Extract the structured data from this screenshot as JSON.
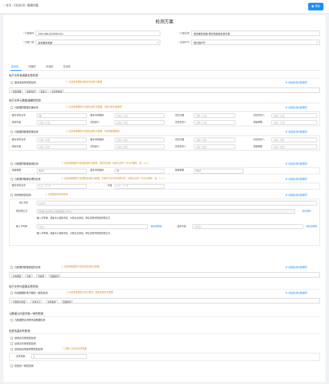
{
  "breadcrumb": {
    "home": "首页",
    "sep1": "/",
    "mid": "归档检测",
    "sep2": "/",
    "current": "检测方案"
  },
  "toolbar": {
    "save_label": "保存"
  },
  "title": "检测方案",
  "form": {
    "plan_no_label": "方案编号",
    "plan_no_value": "GKH-068-2023092l-001",
    "plan_name_label": "方案名称",
    "plan_name_value": "政务服务档案-预归档接收检测方案",
    "dept_label": "归属门类",
    "dept_value": "政务服务档案",
    "stage_label": "检测环节",
    "stage_value": "预归档环节"
  },
  "tabs": [
    "真实性",
    "完整性",
    "可用性",
    "安全性"
  ],
  "sections": {
    "s1": "电子文件来源真实性检测",
    "s2": "电子文件元数据准确性检测",
    "s3": "电子文件内容真实性检测",
    "s4": "元数据与内容关联一致性检测",
    "s5": "信息包真实性检测"
  },
  "checks": {
    "c1": "固化信息有效性检测",
    "c1_hint": "请选择需要检测固化信息的元数据",
    "c2": "元数据项数据长度检测",
    "c2_hint": "请选择需要进行长度检测的元数据，并填写其长度要求",
    "c3": "元数据项数据类型检测",
    "c3_hint": "请选择需要进行类型检测的元数据，并选择数据类型",
    "c4": "元数据项数据值域检测",
    "c4_hint": "请选择需要进行值域检测的元数据，并填写值域，用英文逗号\",\"作为分隔符，如：0,1,2",
    "c5": "元数据项数据合理性检测",
    "c5_hint": "请选择需要进行合理性检测的元数据，并填写不允许的特殊字符，用英文逗号\",\"作为分隔符，如：\\,/,:,*,?",
    "c6": "档号规范性检测",
    "c6_hint": "请配置档号构成规则",
    "c7": "元数据项数据重复性检测",
    "c7_hint": "请选择需要进行重复性检测的元数据",
    "c8": "内容数据的电子属性一致性检测",
    "c8_hint": "请选择需要进行电子属性一致性检测的元数据",
    "c9": "元数据是否关联内容数据检测",
    "c10": "说明文件规范性检测",
    "c11": "目录文件规范性检测",
    "c12": "信息包目录结构规范性检测",
    "c12_hint": "请输入信息包目录层级",
    "c13": "信息包一致性检测"
  },
  "add_label": "添加检测元数据项",
  "tags": {
    "t1": [
      "签名结果",
      "签名时间",
      "签名人",
      "证书有效性"
    ],
    "t2": [
      "文件题名",
      "分类",
      "分类号",
      "创建时间"
    ],
    "t3": [
      "计算机文件名",
      "文件大小",
      "文件格式",
      "创建时间"
    ]
  },
  "grid_labels": {
    "item": "服务事项名称",
    "code": "服务事项编码",
    "handle_date": "归档日期",
    "handle_person": "归档责任人",
    "year": "档案年度",
    "duration": "保管期限",
    "dept": "归档部门",
    "keep_label": "保管期限",
    "keep2": "服务事项编码",
    "year2": "年度"
  },
  "grid_values": {
    "len1": "12",
    "ph_len": "请输入长度",
    "ph_type": "请输入类型",
    "range1": "0,1,2",
    "range2": "01",
    "range3": "0,1,2",
    "special": "\\ , / , : , * , ?"
  },
  "rules": {
    "flow_label": "流水字段",
    "flow_value": "请选择",
    "expr_label": "规则表达式",
    "expr_value": "{年度}-{分类号}-{保管期限}-{件号}",
    "expr_link": "清空规则",
    "expr_tip": "输入字符串，或者可以选择字段，分别点击添加，即生成档号规则的表达式。",
    "str_label": "输入字符串",
    "str_ph": "请输入",
    "str_add": "添加到规则",
    "field_label": "选择字段",
    "field_ph": "请选择",
    "field_add": "添加到规则",
    "tip2": "输入字符串，或者可以选择字段，分别点击添加，即生成档号规则的表达式。"
  },
  "dir": {
    "label": "目录层级",
    "value": "1"
  }
}
